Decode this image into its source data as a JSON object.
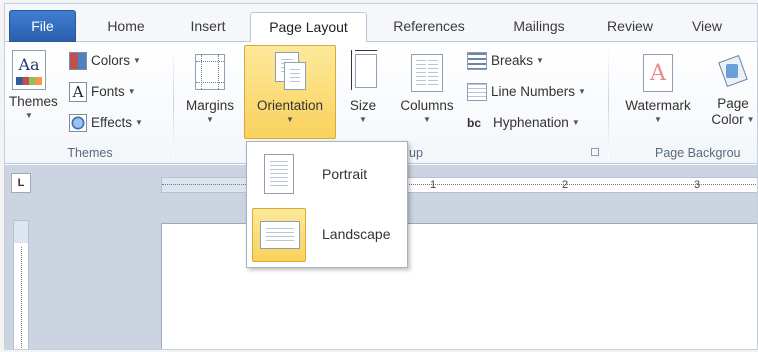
{
  "tabs": {
    "file": "File",
    "home": "Home",
    "insert": "Insert",
    "page_layout": "Page Layout",
    "references": "References",
    "mailings": "Mailings",
    "review": "Review",
    "view": "View"
  },
  "themes_group": {
    "themes_label": "Themes",
    "colors_label": "Colors",
    "fonts_label": "Fonts",
    "effects_label": "Effects",
    "group_label": "Themes",
    "themes_icon_text": "Aa",
    "fonts_icon_text": "A"
  },
  "page_setup_group": {
    "margins_label": "Margins",
    "orientation_label": "Orientation",
    "size_label": "Size",
    "columns_label": "Columns",
    "breaks_label": "Breaks",
    "line_numbers_label": "Line Numbers",
    "hyphenation_label": "Hyphenation",
    "group_label_partial": "up",
    "hyphenation_icon_text": "bc"
  },
  "page_background_group": {
    "watermark_label": "Watermark",
    "page_color_label_1": "Page",
    "page_color_label_2": "Color",
    "group_label": "Page Backgrou"
  },
  "ruler": {
    "corner_label": "L",
    "numbers": [
      "1",
      "2",
      "3"
    ]
  },
  "orientation_menu": {
    "portrait_label": "Portrait",
    "landscape_label": "Landscape",
    "selected": "Landscape"
  },
  "colors": {
    "file_tab": "#2a5fae",
    "pressed": "#f9d15c",
    "ribbon_border": "#b9c9dc"
  }
}
